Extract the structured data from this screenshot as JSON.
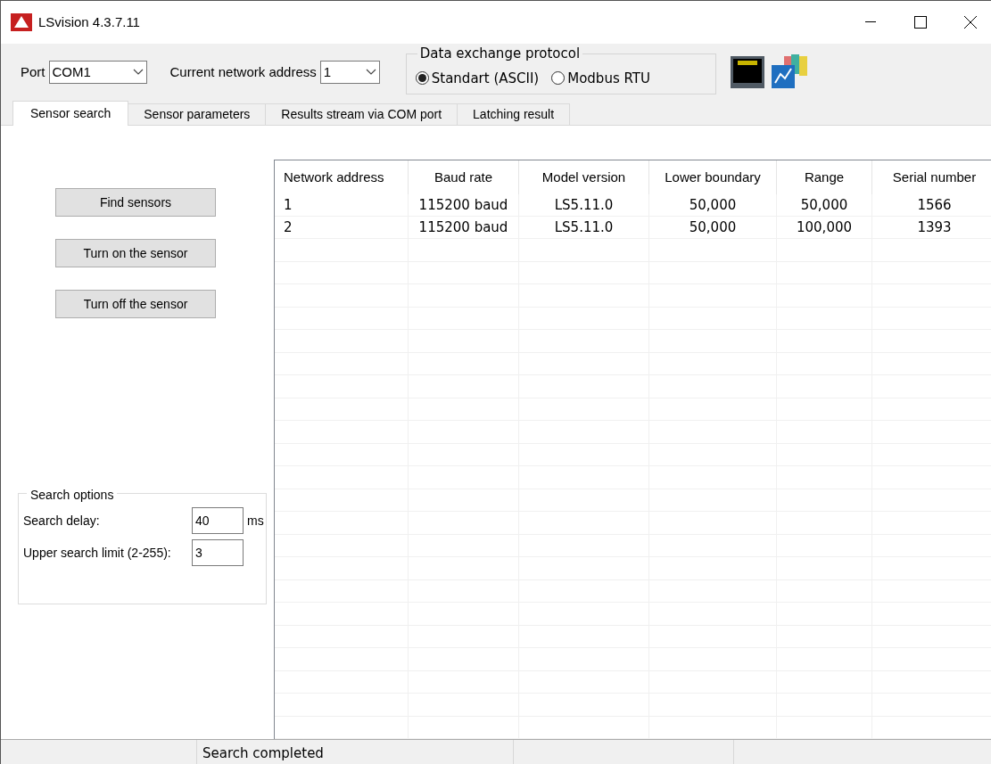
{
  "window": {
    "title": "LSvision 4.3.7.11"
  },
  "toolbar": {
    "port_label": "Port",
    "port_value": "COM1",
    "address_label": "Current network address",
    "address_value": "1",
    "protocol": {
      "title": "Data exchange protocol",
      "options": [
        {
          "label": "Standart (ASCII)",
          "selected": true
        },
        {
          "label": "Modbus RTU",
          "selected": false
        }
      ]
    }
  },
  "tabs": [
    {
      "label": "Sensor search",
      "selected": true
    },
    {
      "label": "Sensor parameters",
      "selected": false
    },
    {
      "label": "Results stream via COM port",
      "selected": false
    },
    {
      "label": "Latching result",
      "selected": false
    }
  ],
  "buttons": [
    "Find sensors",
    "Turn on the sensor",
    "Turn off the sensor"
  ],
  "search_options": {
    "title": "Search options",
    "delay_label": "Search delay:",
    "delay_value": "40",
    "delay_unit": "ms",
    "limit_label": "Upper search limit (2-255):",
    "limit_value": "3"
  },
  "table": {
    "columns": [
      "Network address",
      "Baud rate",
      "Model version",
      "Lower boundary",
      "Range",
      "Serial number"
    ],
    "rows": [
      [
        "1",
        "115200 baud",
        "LS5.11.0",
        "50,000",
        "50,000",
        "1566"
      ],
      [
        "2",
        "115200 baud",
        "LS5.11.0",
        "50,000",
        "100,000",
        "1393"
      ]
    ]
  },
  "status_bar": {
    "text": "Search completed"
  }
}
